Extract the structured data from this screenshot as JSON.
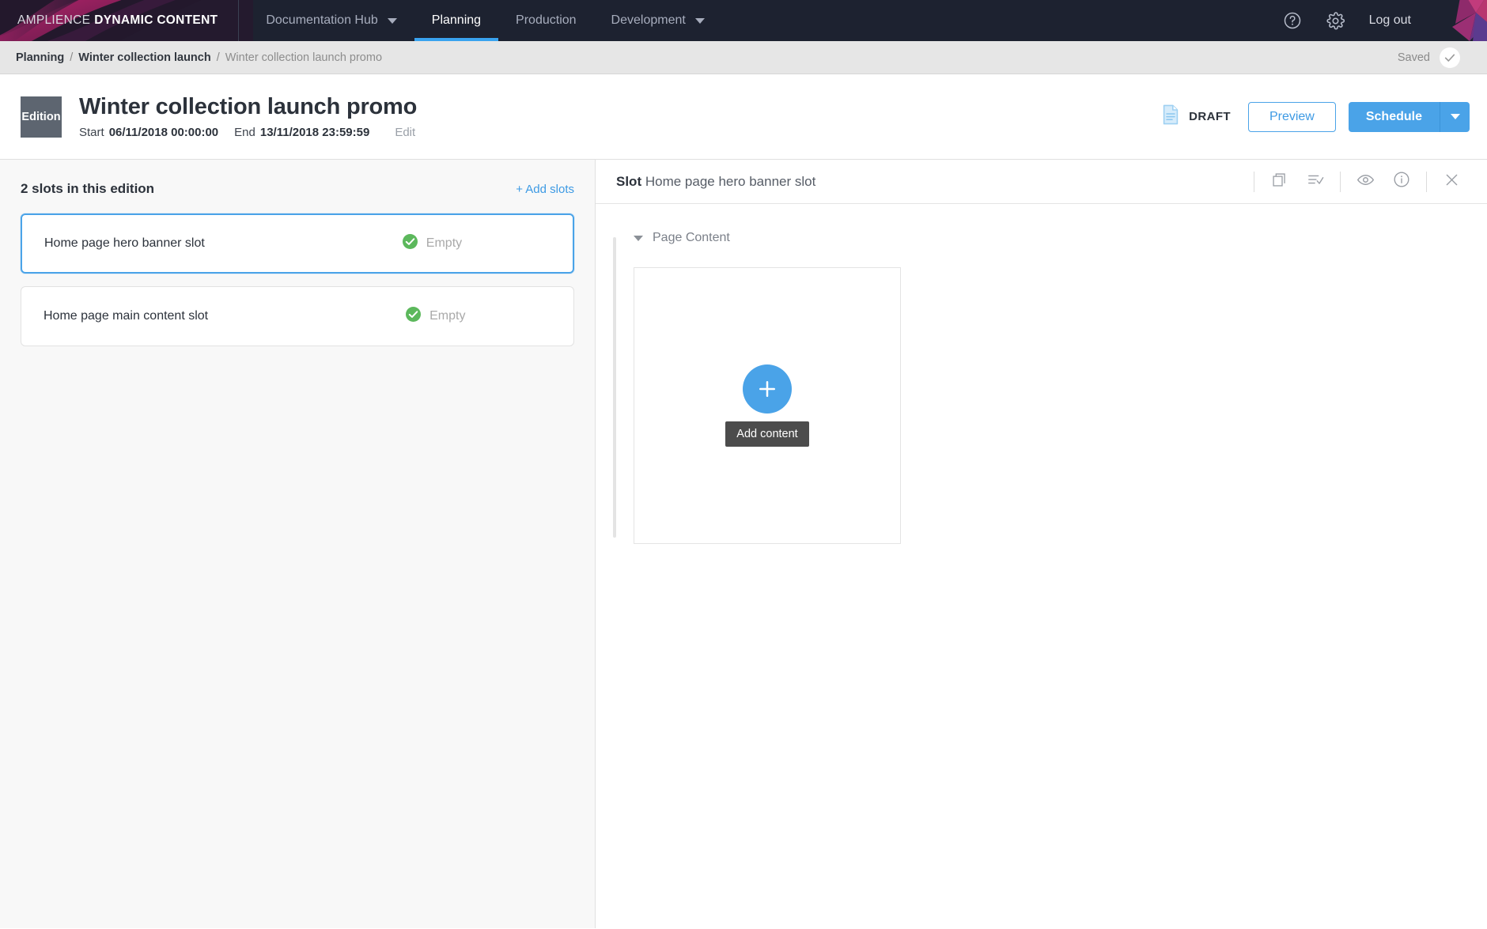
{
  "topnav": {
    "brand_light": "AMPLIENCE",
    "brand_bold": "DYNAMIC CONTENT",
    "tabs": [
      {
        "label": "Documentation Hub",
        "active": false,
        "has_caret": true
      },
      {
        "label": "Planning",
        "active": true,
        "has_caret": false
      },
      {
        "label": "Production",
        "active": false,
        "has_caret": false
      },
      {
        "label": "Development",
        "active": false,
        "has_caret": true
      }
    ],
    "help_icon": "help-circle-icon",
    "settings_icon": "gear-icon",
    "logout_label": "Log out",
    "accent_color": "#39a3ef",
    "bg_color": "#1d2230"
  },
  "breadcrumb": {
    "items": [
      {
        "label": "Planning",
        "current": false
      },
      {
        "label": "Winter collection launch",
        "current": false
      },
      {
        "label": "Winter collection launch promo",
        "current": true
      }
    ],
    "separator": "/",
    "save_status": "Saved",
    "save_icon": "check-icon"
  },
  "pageheader": {
    "badge_label": "Edition",
    "title": "Winter collection launch promo",
    "start_label": "Start",
    "start_value": "06/11/2018 00:00:00",
    "end_label": "End",
    "end_value": "13/11/2018 23:59:59",
    "edit_label": "Edit",
    "status_label": "DRAFT",
    "status_icon": "draft-document-icon",
    "preview_label": "Preview",
    "schedule_label": "Schedule",
    "schedule_caret_icon": "chevron-down-icon",
    "primary_color": "#4aa3e8"
  },
  "slots_panel": {
    "heading": "2 slots in this edition",
    "add_slots_label": "+ Add slots",
    "slots": [
      {
        "name": "Home page hero banner slot",
        "status": "Empty",
        "status_icon": "check-circle-icon",
        "selected": true
      },
      {
        "name": "Home page main content slot",
        "status": "Empty",
        "status_icon": "check-circle-icon",
        "selected": false
      }
    ],
    "status_color": "#5cb85c"
  },
  "slot_detail": {
    "label": "Slot",
    "name": "Home page hero banner slot",
    "tools": [
      {
        "icon": "copy-icon",
        "name": "duplicate-button"
      },
      {
        "icon": "list-check-icon",
        "name": "checklist-button"
      },
      {
        "icon": "eye-icon",
        "name": "visibility-button"
      },
      {
        "icon": "info-icon",
        "name": "info-button"
      },
      {
        "icon": "close-icon",
        "name": "close-button"
      }
    ],
    "section_title": "Page Content",
    "section_chevron": "chevron-down-icon",
    "add_content_icon": "plus-icon",
    "add_content_tooltip": "Add content"
  }
}
